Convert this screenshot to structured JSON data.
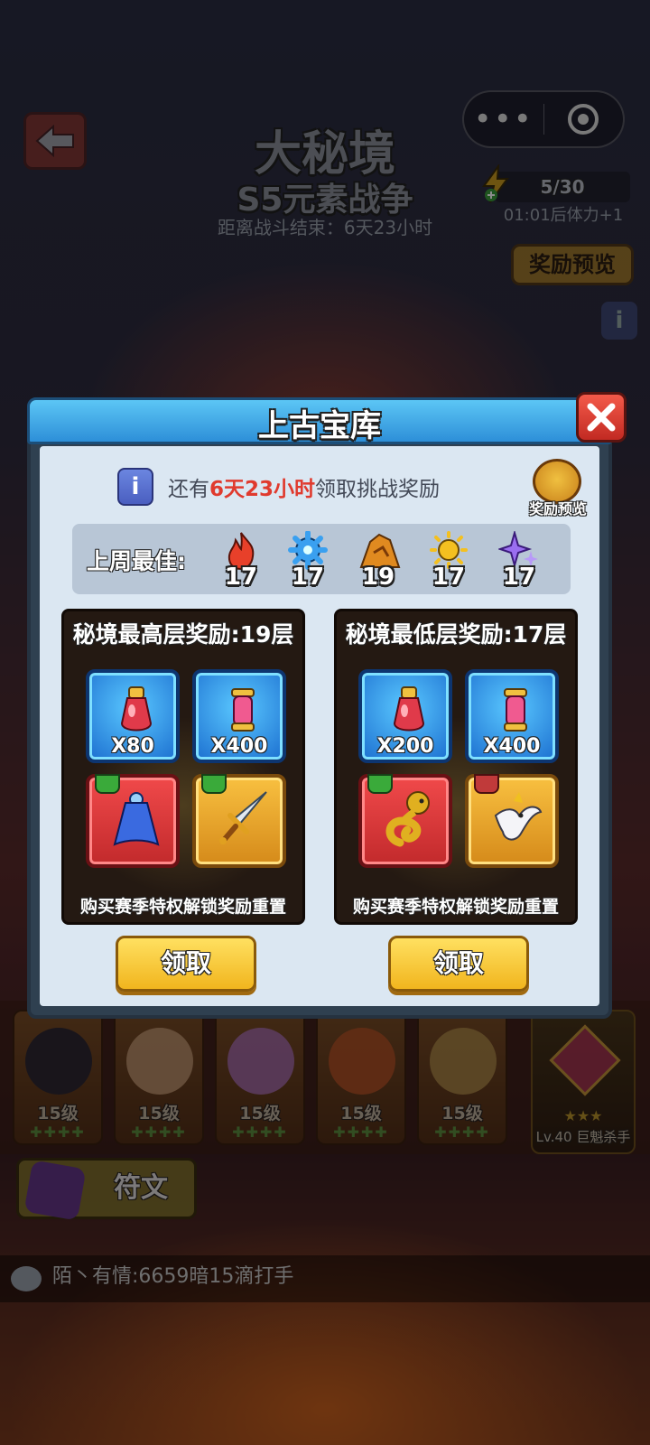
{
  "header": {
    "title": "大秘境",
    "subtitle": "S5元素战争",
    "countdown": "距离战斗结束：6天23小时",
    "energy": "5/30",
    "energy_regen": "01:01后体力+1",
    "reward_preview": "奖励预览"
  },
  "dialog": {
    "title": "上古宝库",
    "notice_prefix": "还有",
    "notice_highlight": "6天23小时",
    "notice_suffix": "领取挑战奖励",
    "chest_label": "奖励预览",
    "best_label": "上周最佳:",
    "best_elements": [
      {
        "icon": "fire-icon",
        "value": "17",
        "color": "#e8402a"
      },
      {
        "icon": "water-gear-icon",
        "value": "17",
        "color": "#3aa0f0"
      },
      {
        "icon": "earth-rock-icon",
        "value": "19",
        "color": "#e08a20"
      },
      {
        "icon": "sun-icon",
        "value": "17",
        "color": "#f4c020"
      },
      {
        "icon": "sparkle-icon",
        "value": "17",
        "color": "#9a6ef0"
      }
    ],
    "panels": [
      {
        "title": "秘境最高层奖励:19层",
        "items": [
          {
            "icon": "potion-bottle-icon",
            "qty": "X80"
          },
          {
            "icon": "scroll-vial-icon",
            "qty": "X400"
          },
          {
            "icon": "blue-cape-icon",
            "qty": ""
          },
          {
            "icon": "sword-icon",
            "qty": ""
          }
        ],
        "note": "购买赛季特权解锁奖励重置",
        "claim": "领取"
      },
      {
        "title": "秘境最低层奖励:17层",
        "items": [
          {
            "icon": "potion-bottle-icon",
            "qty": "X200"
          },
          {
            "icon": "scroll-vial-icon",
            "qty": "X400"
          },
          {
            "icon": "golden-serpent-icon",
            "qty": ""
          },
          {
            "icon": "white-bird-icon",
            "qty": ""
          }
        ],
        "note": "购买赛季特权解锁奖励重置",
        "claim": "领取"
      }
    ]
  },
  "heroes": [
    {
      "level": "15级"
    },
    {
      "level": "15级"
    },
    {
      "level": "15级"
    },
    {
      "level": "15级"
    },
    {
      "level": "15级"
    }
  ],
  "featured_hero": {
    "stars": "★★★",
    "label": "Lv.40 巨魁杀手"
  },
  "rune_button": "符文",
  "chat": "陌丶有情:6659暗15滴打手",
  "colors": {
    "highlight": "#e03a2e",
    "claim": "#f1b51e",
    "dialog_header": "#2d8fd8"
  }
}
